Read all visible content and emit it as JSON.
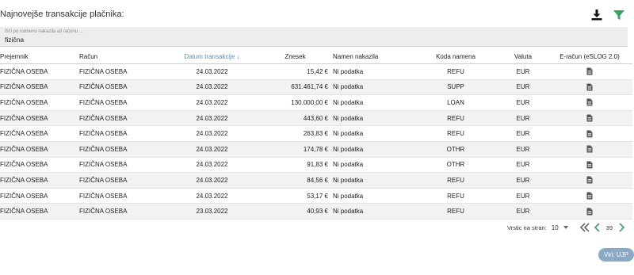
{
  "page": {
    "title": "Najnovejše transakcije plačnika:"
  },
  "icons": {
    "download": "download-icon",
    "filter": "filter-icon",
    "document": "document-icon"
  },
  "colors": {
    "filter_green": "#3aa35c",
    "sort_blue": "#5a8fc0",
    "source_button": "#8aa9c4"
  },
  "search": {
    "placeholder": "Išči po namenu nakazila ali računu ...",
    "value": "fizična"
  },
  "table": {
    "headers": {
      "prejemnik": "Prejemnik",
      "racun": "Račun",
      "datum": "Datum transakcije ↓",
      "znesek": "Znesek",
      "namen": "Namen nakazila",
      "koda": "Koda namena",
      "valuta": "Valuta",
      "eracun": "E-račun (eSLOG 2.0)"
    },
    "rows": [
      {
        "prejemnik": "FIZIČNA OSEBA",
        "racun": "FIZIČNA OSEBA",
        "datum": "24.03.2022",
        "znesek": "15,42 €",
        "namen": "Ni podatka",
        "koda": "REFU",
        "valuta": "EUR"
      },
      {
        "prejemnik": "FIZIČNA OSEBA",
        "racun": "FIZIČNA OSEBA",
        "datum": "24.03.2022",
        "znesek": "631.461,74 €",
        "namen": "Ni podatka",
        "koda": "SUPP",
        "valuta": "EUR"
      },
      {
        "prejemnik": "FIZIČNA OSEBA",
        "racun": "FIZIČNA OSEBA",
        "datum": "24.03.2022",
        "znesek": "130.000,00 €",
        "namen": "Ni podatka",
        "koda": "LOAN",
        "valuta": "EUR"
      },
      {
        "prejemnik": "FIZIČNA OSEBA",
        "racun": "FIZIČNA OSEBA",
        "datum": "24.03.2022",
        "znesek": "443,60 €",
        "namen": "Ni podatka",
        "koda": "REFU",
        "valuta": "EUR"
      },
      {
        "prejemnik": "FIZIČNA OSEBA",
        "racun": "FIZIČNA OSEBA",
        "datum": "24.03.2022",
        "znesek": "263,83 €",
        "namen": "Ni podatka",
        "koda": "REFU",
        "valuta": "EUR"
      },
      {
        "prejemnik": "FIZIČNA OSEBA",
        "racun": "FIZIČNA OSEBA",
        "datum": "24.03.2022",
        "znesek": "174,78 €",
        "namen": "Ni podatka",
        "koda": "OTHR",
        "valuta": "EUR"
      },
      {
        "prejemnik": "FIZIČNA OSEBA",
        "racun": "FIZIČNA OSEBA",
        "datum": "24.03.2022",
        "znesek": "91,83 €",
        "namen": "Ni podatka",
        "koda": "OTHR",
        "valuta": "EUR"
      },
      {
        "prejemnik": "FIZIČNA OSEBA",
        "racun": "FIZIČNA OSEBA",
        "datum": "24.03.2022",
        "znesek": "84,56 €",
        "namen": "Ni podatka",
        "koda": "REFU",
        "valuta": "EUR"
      },
      {
        "prejemnik": "FIZIČNA OSEBA",
        "racun": "FIZIČNA OSEBA",
        "datum": "24.03.2022",
        "znesek": "53,17 €",
        "namen": "Ni podatka",
        "koda": "REFU",
        "valuta": "EUR"
      },
      {
        "prejemnik": "FIZIČNA OSEBA",
        "racun": "FIZIČNA OSEBA",
        "datum": "23.03.2022",
        "znesek": "40,93 €",
        "namen": "Ni podatka",
        "koda": "REFU",
        "valuta": "EUR"
      }
    ]
  },
  "pagination": {
    "rows_label": "Vrstic na stran:",
    "rows_per_page": "10",
    "page": "39"
  },
  "source_button": {
    "label": "Viri: UJP"
  }
}
